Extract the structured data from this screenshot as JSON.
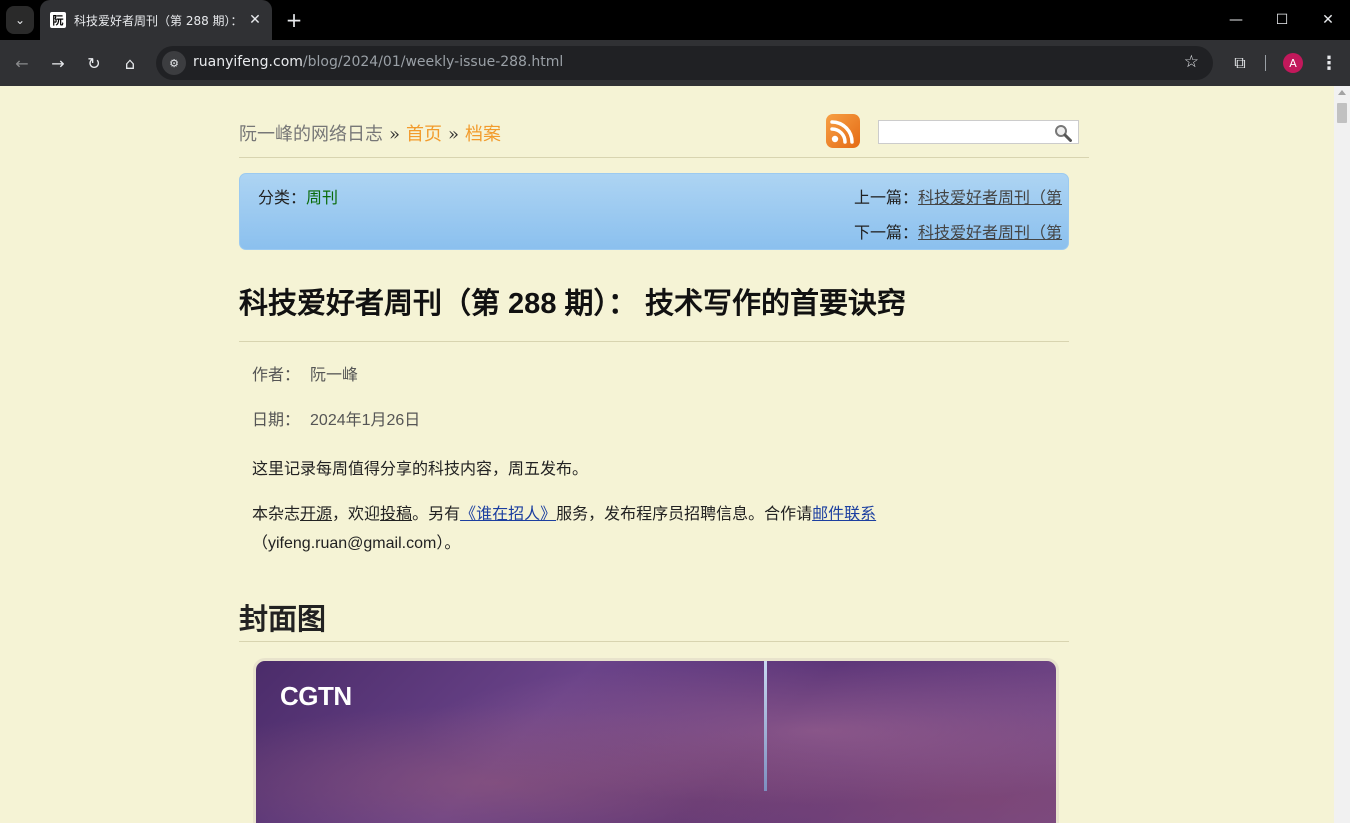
{
  "browser": {
    "tab_title": "科技爱好者周刊（第 288 期）：",
    "favicon_glyph": "阮",
    "url_host": "ruanyifeng.com",
    "url_path": "/blog/2024/01/weekly-issue-288.html",
    "profile_initial": "A",
    "profile_color": "#c2185b"
  },
  "header": {
    "site_name": "阮一峰的网络日志",
    "sep": "»",
    "home_link": "首页",
    "archive_link": "档案",
    "accent_color": "#f29b2c"
  },
  "infobox": {
    "category_label": "分类：",
    "category_link": "周刊",
    "prev_label": "上一篇：",
    "prev_link": "科技爱好者周刊（第",
    "next_label": "下一篇：",
    "next_link": "科技爱好者周刊（第"
  },
  "article": {
    "title": "科技爱好者周刊（第 288 期）： 技术写作的首要诀窍",
    "author_label": "作者：",
    "author": "阮一峰",
    "date_label": "日期：",
    "date": "2024年1月26日",
    "intro": "这里记录每周值得分享的科技内容，周五发布。",
    "p2_a": "本杂志",
    "p2_link1": "开源",
    "p2_b": "，欢迎",
    "p2_link2": "投稿",
    "p2_c": "。另有",
    "p2_link3": "《谁在招人》",
    "p2_d": "服务，发布程序员招聘信息。合作请",
    "p2_link4": "邮件联系",
    "p2_line2": "（yifeng.ruan@gmail.com）。",
    "section_heading": "封面图",
    "cover_logo": "CGTN"
  }
}
